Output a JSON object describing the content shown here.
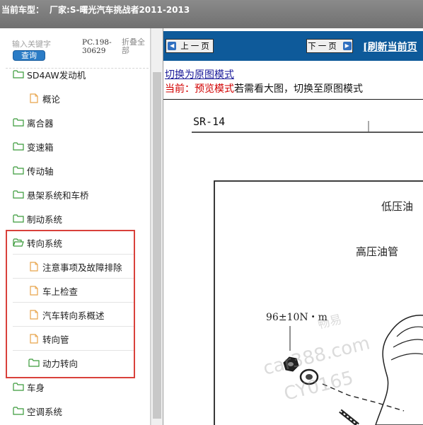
{
  "title": {
    "prefix": "当前车型：",
    "model": "厂家:S-曙光汽车挑战者2011-2013"
  },
  "search": {
    "placeholder": "输入关键字",
    "button": "查询",
    "code": "PC.198-30629",
    "collapse_all": "折叠全部"
  },
  "tree": {
    "items": [
      {
        "label": "SD4AW发动机",
        "level": 0
      },
      {
        "label": "概论",
        "level": 1
      },
      {
        "label": "离合器",
        "level": 0
      },
      {
        "label": "变速箱",
        "level": 0
      },
      {
        "label": "传动轴",
        "level": 0
      },
      {
        "label": "悬架系统和车桥",
        "level": 0
      },
      {
        "label": "制动系统",
        "level": 0
      },
      {
        "label": "转向系统",
        "level": 0
      },
      {
        "label": "注意事项及故障排除",
        "level": 1
      },
      {
        "label": "车上检查",
        "level": 1
      },
      {
        "label": "汽车转向系概述",
        "level": 1
      },
      {
        "label": "转向管",
        "level": 1
      },
      {
        "label": "动力转向",
        "level": 1
      },
      {
        "label": "车身",
        "level": 0
      },
      {
        "label": "空调系统",
        "level": 0
      }
    ]
  },
  "content": {
    "prev_page": "上一页",
    "next_page": "下一页",
    "refresh": "[刷新当前页",
    "switch_original": "切换为原图模式",
    "mode_current_label": "当前：预览模式",
    "mode_hint": "若需看大图，切换至原图模式"
  },
  "diagram": {
    "section": "SR-14",
    "low_pressure": "低压油",
    "high_pressure": "高压油管",
    "torque": "96±10N・m",
    "watermark_1": "car388.com",
    "watermark_2": "CY0165",
    "watermark_3": "畅易"
  },
  "colors": {
    "titlebar": "#7a7a7a",
    "navbar": "#0e5a9a",
    "highlight_box": "#d9413b",
    "folder_icon": "#3a9a3a",
    "doc_icon": "#e8a44a",
    "search_button": "#2b7cc6",
    "mode_red": "#d10000"
  },
  "icons": {
    "folder": "folder-icon",
    "document": "document-icon",
    "arrow_left": "arrow-left-icon",
    "arrow_right": "arrow-right-icon"
  }
}
